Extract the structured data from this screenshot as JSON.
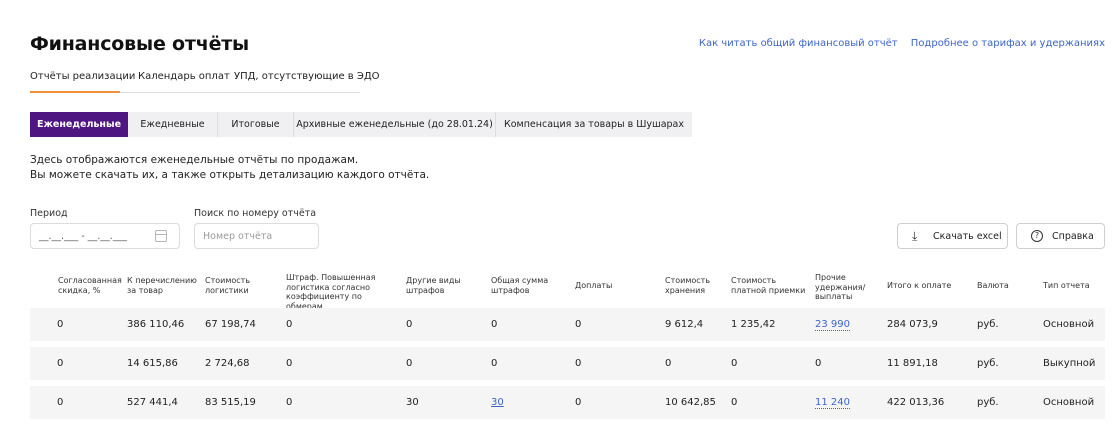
{
  "page": {
    "title": "Финансовые отчёты",
    "links": [
      "Как читать общий финансовый отчёт",
      "Подробнее о тарифах и удержаниях"
    ]
  },
  "main_tabs": [
    {
      "label": "Отчёты реализации",
      "active": true
    },
    {
      "label": "Календарь оплат",
      "active": false
    },
    {
      "label": "УПД, отсутствующие в ЭДО",
      "active": false
    }
  ],
  "report_types": [
    {
      "label": "Еженедельные",
      "active": true
    },
    {
      "label": "Ежедневные",
      "active": false
    },
    {
      "label": "Итоговые",
      "active": false
    },
    {
      "label": "Архивные еженедельные (до 28.01.24)",
      "active": false
    },
    {
      "label": "Компенсация за товары в Шушарах",
      "active": false
    }
  ],
  "description": {
    "line1": "Здесь отображаются еженедельные отчёты по продажам.",
    "line2": "Вы можете скачать их, а также открыть детализацию каждого отчёта."
  },
  "filters": {
    "period_label": "Период",
    "period_value": "__.__.___ - __.__.___",
    "search_label": "Поиск по номеру отчёта",
    "search_placeholder": "Номер отчёта"
  },
  "buttons": {
    "excel": "Скачать excel",
    "help": "Справка"
  },
  "table": {
    "headers": {
      "discount": "Согласованная скидка, %",
      "transfer": "К перечислению за товар",
      "logistics": "Стоимость логистики",
      "penalty": "Штраф. Повышенная логистика согласно коэффициенту по обмерам",
      "other_fines": "Другие виды штрафов",
      "fines_total": "Общая сумма штрафов",
      "surcharges": "Доплаты",
      "storage": "Стоимость хранения",
      "paid_acceptance": "Стоимость платной приемки",
      "other_deductions": "Прочие удержания/ выплаты",
      "total": "Итого к оплате",
      "currency": "Валюта",
      "type": "Тип отчета"
    },
    "rows": [
      {
        "discount": "0",
        "transfer": "386 110,46",
        "logistics": "67 198,74",
        "penalty": "0",
        "other_fines": "0",
        "fines_total": "0",
        "surcharges": "0",
        "storage": "9 612,4",
        "paid_acceptance": "1 235,42",
        "other_deductions": "23 990",
        "total": "284 073,9",
        "currency": "руб.",
        "type": "Основной"
      },
      {
        "discount": "0",
        "transfer": "14 615,86",
        "logistics": "2 724,68",
        "penalty": "0",
        "other_fines": "0",
        "fines_total": "0",
        "surcharges": "0",
        "storage": "0",
        "paid_acceptance": "0",
        "other_deductions": "0",
        "total": "11 891,18",
        "currency": "руб.",
        "type": "Выкупной"
      },
      {
        "discount": "0",
        "transfer": "527 441,4",
        "logistics": "83 515,19",
        "penalty": "0",
        "other_fines": "30",
        "fines_total": "30",
        "surcharges": "0",
        "storage": "10 642,85",
        "paid_acceptance": "0",
        "other_deductions": "11 240",
        "total": "422 013,36",
        "currency": "руб.",
        "type": "Основной"
      }
    ]
  },
  "colors": {
    "accent_purple": "#4d1680",
    "tab_underline": "#f28e3c",
    "link_blue": "#3d64c8"
  }
}
